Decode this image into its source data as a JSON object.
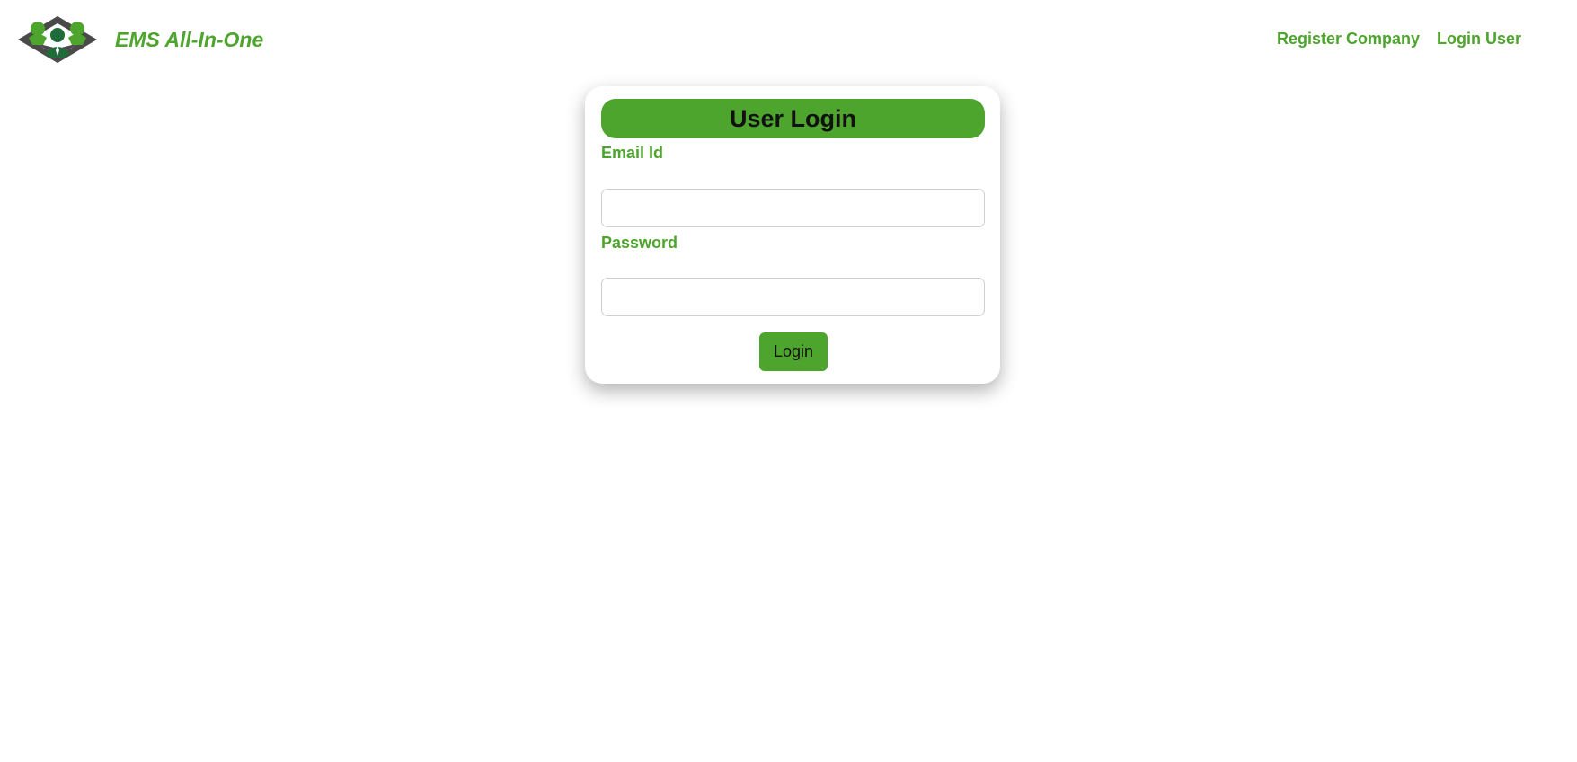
{
  "brand": {
    "name": "EMS All-In-One",
    "logo_icon": "ems-team-logo-icon"
  },
  "nav": {
    "links": [
      "Register Company",
      "Login User"
    ]
  },
  "login_card": {
    "title": "User Login",
    "email": {
      "label": "Email Id",
      "value": "",
      "placeholder": ""
    },
    "password": {
      "label": "Password",
      "value": "",
      "placeholder": ""
    },
    "submit_label": "Login"
  },
  "colors": {
    "accent": "#4ea52d",
    "logo_dark": "#4a4a4a",
    "logo_green_dark": "#1f6b3a"
  }
}
